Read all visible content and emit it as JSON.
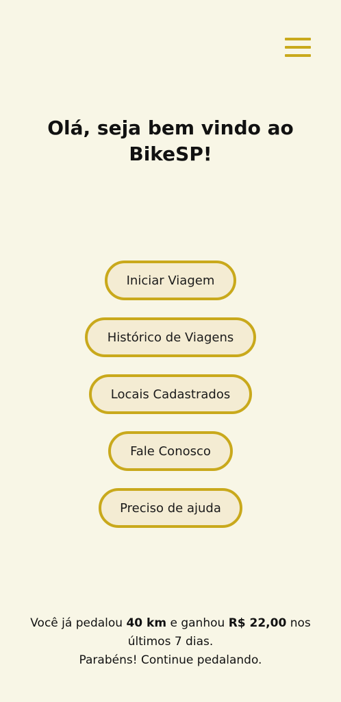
{
  "header": {
    "menu_icon": "hamburger-menu-icon",
    "accent_color": "#C9A91C"
  },
  "welcome": {
    "title": "Olá, seja bem vindo ao BikeSP!"
  },
  "menu": {
    "buttons": [
      {
        "label": "Iniciar Viagem"
      },
      {
        "label": "Histórico de Viagens"
      },
      {
        "label": "Locais Cadastrados"
      },
      {
        "label": "Fale Conosco"
      },
      {
        "label": "Preciso de ajuda"
      }
    ]
  },
  "summary": {
    "prefix": "Você já pedalou ",
    "distance": "40 km",
    "middle": " e ganhou ",
    "earnings": "R$ 22,00",
    "suffix": " nos últimos 7 dias.",
    "congrats": "Parabéns! Continue pedalando."
  },
  "colors": {
    "background": "#F8F6E6",
    "button_fill": "#F4ECD3",
    "button_border": "#C9A91C"
  }
}
